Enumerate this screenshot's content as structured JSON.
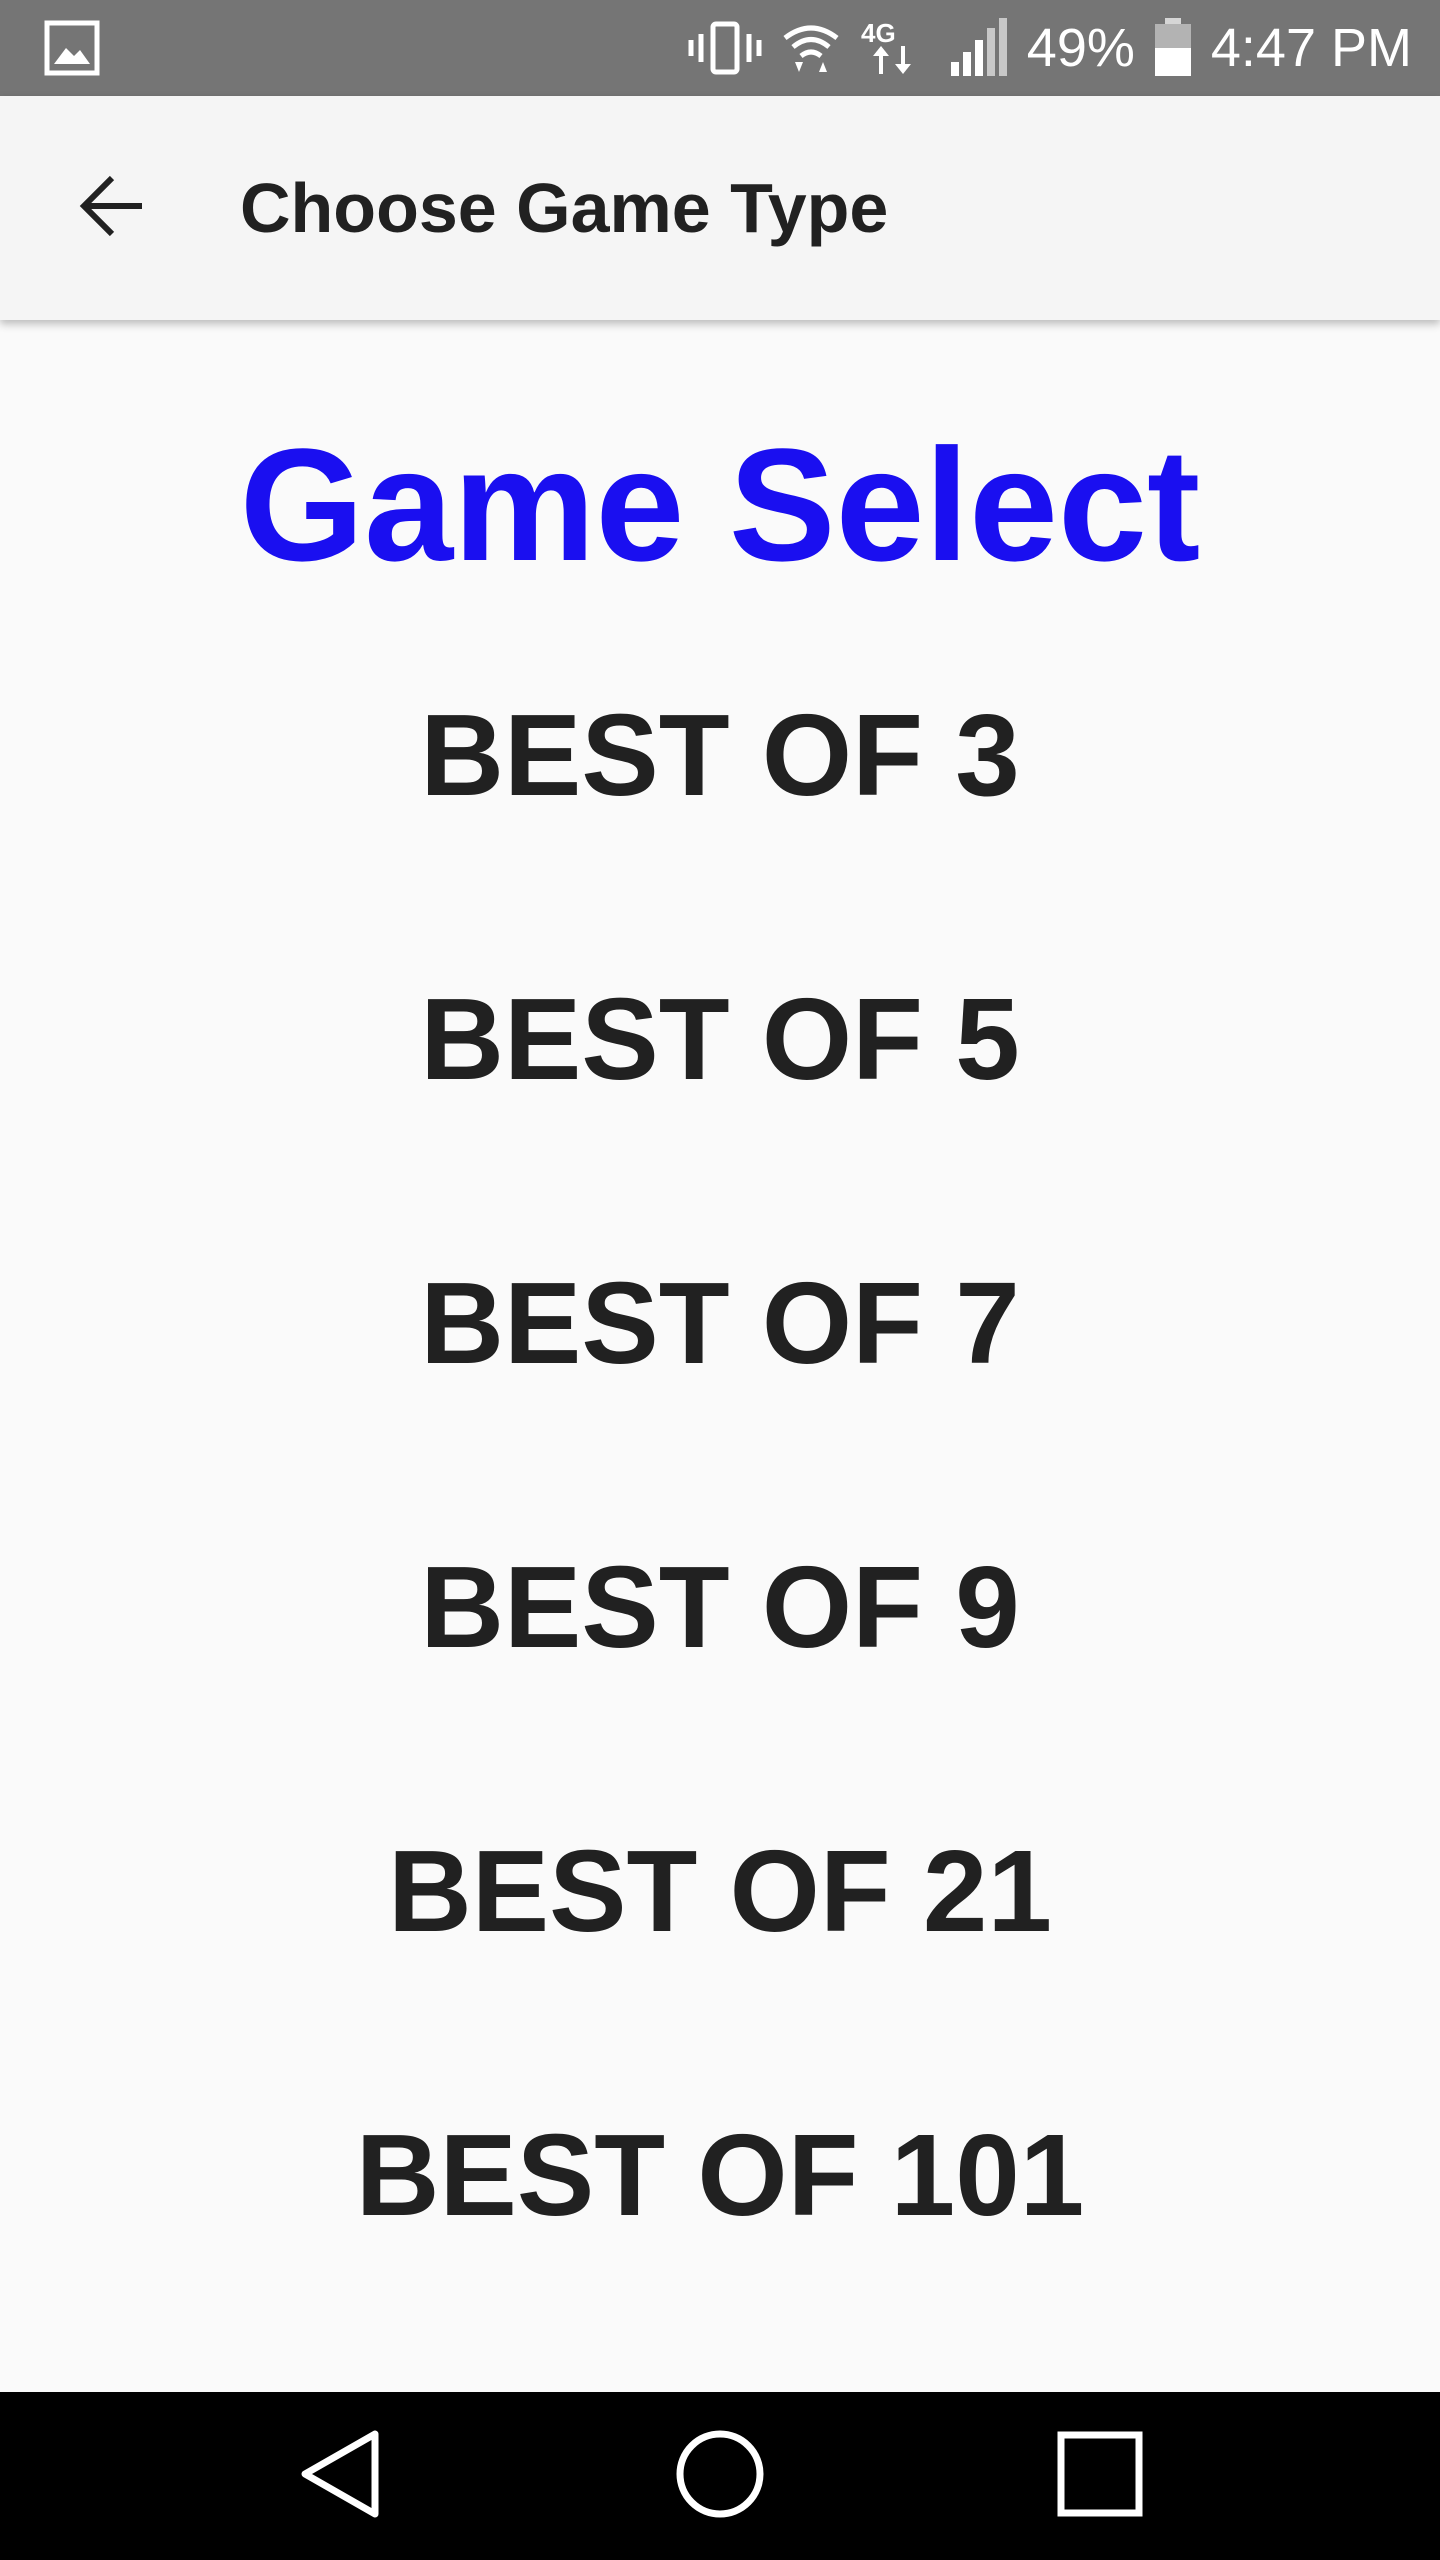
{
  "status_bar": {
    "battery": "49%",
    "time": "4:47 PM",
    "network": "4G",
    "icons": [
      "image-notification-icon",
      "vibrate-icon",
      "wifi-icon",
      "4g-lte-icon",
      "signal-icon",
      "battery-icon"
    ]
  },
  "app_bar": {
    "title": "Choose Game Type",
    "back_icon": "arrow-left-icon"
  },
  "main": {
    "heading": "Game Select",
    "heading_color": "#1a0ff0",
    "options": [
      {
        "label": "BEST OF 3"
      },
      {
        "label": "BEST OF 5"
      },
      {
        "label": "BEST OF 7"
      },
      {
        "label": "BEST OF 9"
      },
      {
        "label": "BEST OF 21"
      },
      {
        "label": "BEST OF 101"
      }
    ]
  },
  "nav_bar": {
    "icons": [
      "back-triangle-icon",
      "home-circle-icon",
      "recents-square-icon"
    ]
  }
}
